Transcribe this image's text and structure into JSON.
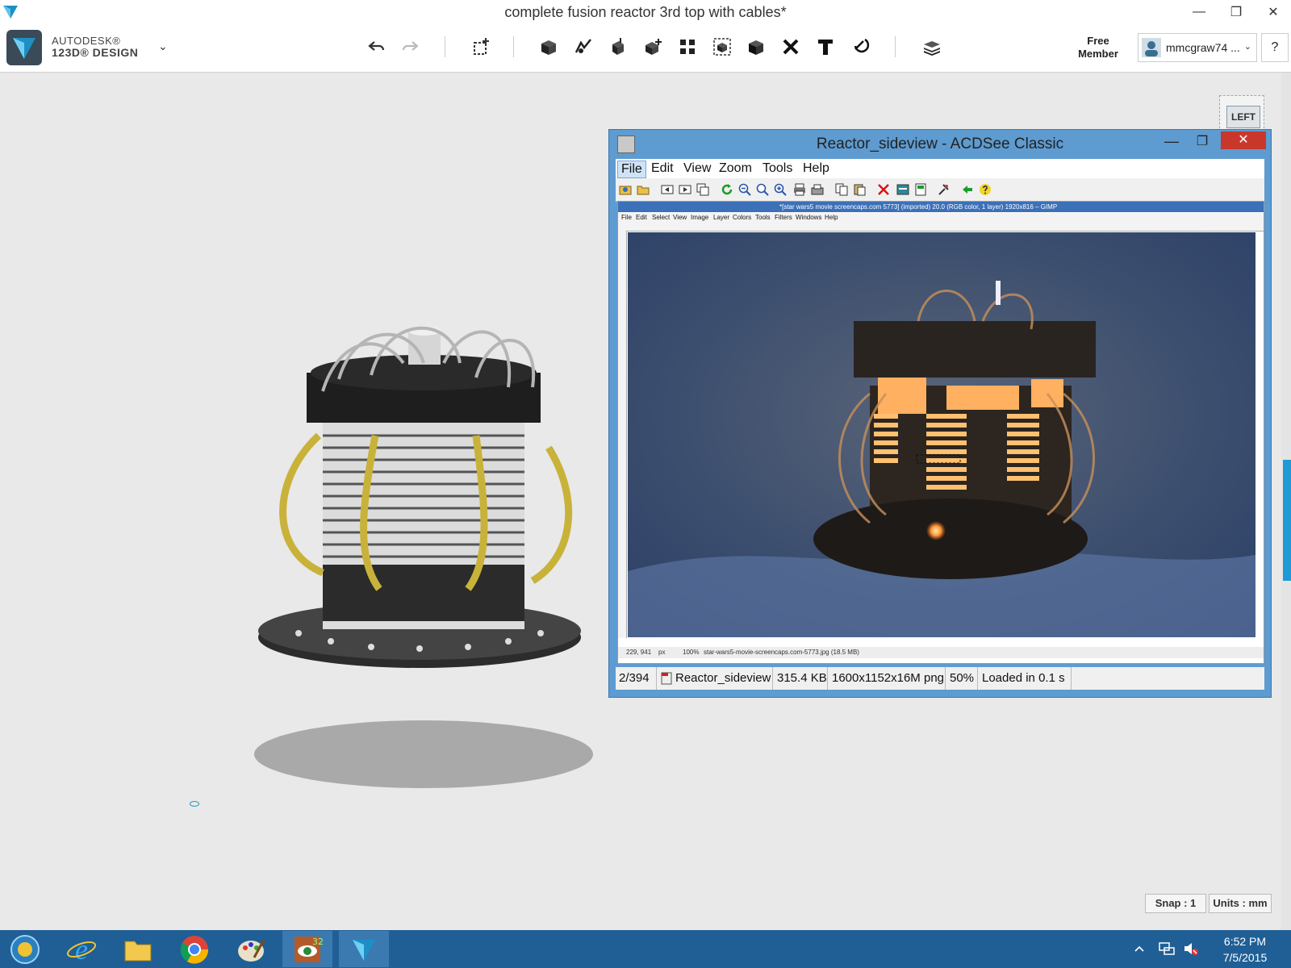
{
  "window": {
    "title": "complete fusion reactor 3rd top with cables*",
    "minimize": "—",
    "maximize": "❐",
    "close": "✕"
  },
  "brand": {
    "line1": "AUTODESK®",
    "line2": "123D® DESIGN",
    "menu_arrow": "⌄"
  },
  "toolbar": {
    "tools": [
      "undo-icon",
      "redo-icon",
      "transform-icon",
      "primitives-icon",
      "sketch-icon",
      "construct-icon",
      "modify-icon",
      "pattern-icon",
      "group-icon",
      "combine-icon",
      "measure-icon",
      "text-icon",
      "snap-icon",
      "material-icon"
    ]
  },
  "account": {
    "member_label": "Free Member",
    "username": "mmcgraw74 ...",
    "dropdown": "⌄",
    "help": "?"
  },
  "viewcube": {
    "face": "LEFT"
  },
  "status": {
    "snap": "Snap : 1",
    "units": "Units : mm"
  },
  "acdsee": {
    "title": "Reactor_sideview - ACDSee Classic",
    "menus": [
      "File",
      "Edit",
      "View",
      "Zoom",
      "Tools",
      "Help"
    ],
    "gimp": {
      "title": "*[star wars5 movie screencaps.com 5773] (imported) 20.0 (RGB color, 1 layer) 1920x816 – GIMP",
      "menus": [
        "File",
        "Edit",
        "Select",
        "View",
        "Image",
        "Layer",
        "Colors",
        "Tools",
        "Filters",
        "Windows",
        "Help"
      ],
      "status_coords": "229, 941",
      "status_unit": "px",
      "status_zoom": "100%",
      "status_file": "star-wars5-movie-screencaps.com-5773.jpg (18.5 MB)"
    },
    "statusbar": {
      "index": "2/394",
      "filename": "Reactor_sideview",
      "filesize": "315.4 KB",
      "dimensions": "1600x1152x16M png",
      "zoom": "50%",
      "loaded": "Loaded in 0.1 s"
    }
  },
  "taskbar": {
    "apps": [
      "start-orb",
      "internet-explorer",
      "file-explorer",
      "chrome",
      "paint",
      "acdsee",
      "123d-design"
    ],
    "time": "6:52 PM",
    "date": "7/5/2015"
  }
}
